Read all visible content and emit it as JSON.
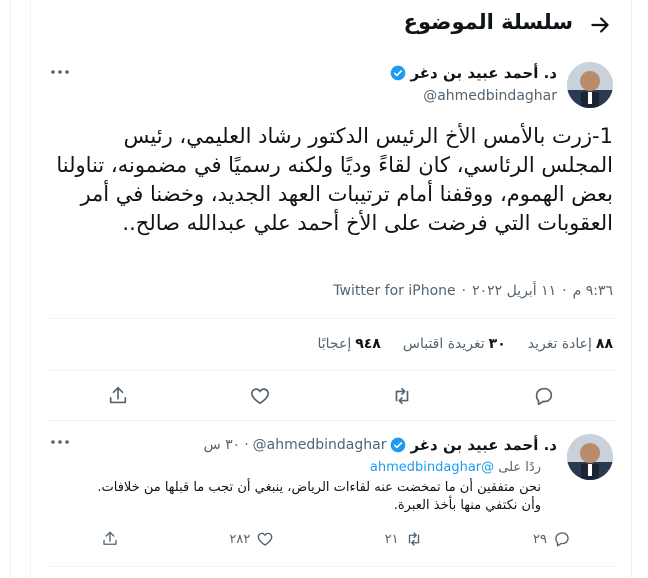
{
  "header": {
    "title": "سلسلة الموضوع"
  },
  "main_tweet": {
    "author_name": "د. أحمد عبيد بن دغر",
    "handle": "@ahmedbindaghar",
    "text": "1-زرت بالأمس الأخ الرئيس الدكتور رشاد العليمي، رئيس المجلس الرئاسي، كان لقاءً وديًا ولكنه رسميًا في مضمونه، تناولنا بعض الهموم، ووقفنا أمام ترتيبات العهد الجديد، وخضنا في أمر العقوبات التي فرضت على الأخ أحمد علي عبدالله صالح..",
    "time": "٩:٣٦ م",
    "date": "١١ أبريل ٢٠٢٢",
    "separator": "·",
    "client": "Twitter for iPhone",
    "stats": {
      "retweets_count": "٨٨",
      "retweets_label": "إعادة تغريد",
      "quotes_count": "٣٠",
      "quotes_label": "تغريدة اقتباس",
      "likes_count": "٩٤٨",
      "likes_label": "إعجابًا"
    }
  },
  "reply_tweet": {
    "author_name": "د. أحمد عبيد بن دغر",
    "handle": "@ahmedbindaghar",
    "time_ago": "٣٠ س",
    "replying_label": "ردًا على",
    "replying_to": "@ahmedbindaghar",
    "text_line1": "نحن متفقين أن ما تمخضت عنه لقاءات الرياض، ينبغي أن تجب ما قبلها من خلافات.",
    "text_line2": "وأن نكتفي منها بأخذ العبرة.",
    "reply_count": "٢٩",
    "retweet_count": "٢١",
    "like_count": "٢٨٢"
  },
  "colors": {
    "accent": "#1d9bf0",
    "text": "#0f1419",
    "muted": "#536471",
    "border": "#eff3f4"
  },
  "icons": [
    "back-arrow-icon",
    "verified-badge-icon",
    "more-icon",
    "reply-icon",
    "retweet-icon",
    "like-icon",
    "share-icon"
  ]
}
